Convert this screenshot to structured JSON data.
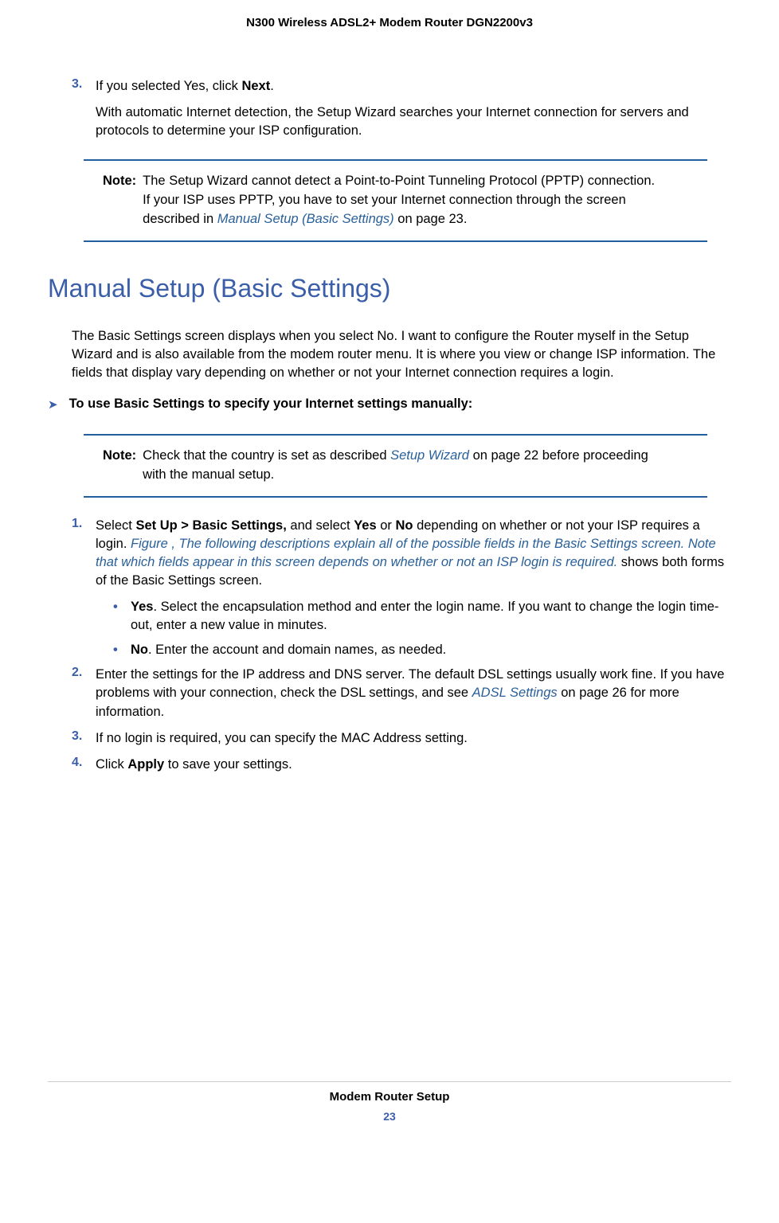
{
  "header": {
    "title": "N300 Wireless ADSL2+ Modem Router DGN2200v3"
  },
  "step3": {
    "marker": "3.",
    "line1_pre": "If you selected Yes, click ",
    "line1_bold": "Next",
    "line1_post": ".",
    "line2": "With automatic Internet detection, the Setup Wizard searches your Internet connection for servers and protocols to determine your ISP configuration."
  },
  "note1": {
    "label": "Note:",
    "text_pre": "The Setup Wizard cannot detect a Point-to-Point Tunneling Protocol (PPTP) connection. If your ISP uses PPTP, you have to set your Internet connection through the screen described in ",
    "link": "Manual Setup (Basic Settings)",
    "text_post": " on page 23."
  },
  "section": {
    "heading": "Manual Setup (Basic Settings)",
    "intro": "The Basic Settings screen displays when you select No. I want to configure the Router myself in the Setup Wizard and is also available from the modem router menu. It is where you view or change ISP information. The fields that display vary depending on whether or not your Internet connection requires a login."
  },
  "task": {
    "text": "To use Basic Settings to specify your Internet settings manually:"
  },
  "note2": {
    "label": "Note:",
    "text_pre": "Check that the country is set as described ",
    "link": "Setup Wizard",
    "text_post": " on page 22 before proceeding with the manual setup."
  },
  "steps": {
    "s1": {
      "marker": "1.",
      "p1_a": "Select ",
      "p1_b": "Set Up > Basic Settings,",
      "p1_c": " and select ",
      "p1_d": "Yes",
      "p1_e": " or ",
      "p1_f": "No",
      "p1_g": " depending on whether or not your ISP requires a login. ",
      "p1_link": "Figure , The following descriptions explain all of the possible fields in the Basic Settings screen. Note that which fields appear in this screen depends on whether or not an ISP login is required.",
      "p1_h": " shows both forms of the Basic Settings screen.",
      "b1_bold": "Yes",
      "b1_rest": ". Select the encapsulation method and enter the login name. If you want to change the login time-out, enter a new value in minutes.",
      "b2_bold": "No",
      "b2_rest": ". Enter the account and domain names, as needed."
    },
    "s2": {
      "marker": "2.",
      "p_a": "Enter the settings for the IP address and DNS server. The default DSL settings usually work fine. If you have problems with your connection, check the DSL settings, and see ",
      "p_link": "ADSL Settings",
      "p_b": " on page 26 for more information."
    },
    "s3": {
      "marker": "3.",
      "p": "If no login is required, you can specify the MAC Address setting."
    },
    "s4": {
      "marker": "4.",
      "p_a": "Click ",
      "p_bold": "Apply",
      "p_b": " to save your settings."
    }
  },
  "footer": {
    "title": "Modem Router Setup",
    "page": "23"
  }
}
